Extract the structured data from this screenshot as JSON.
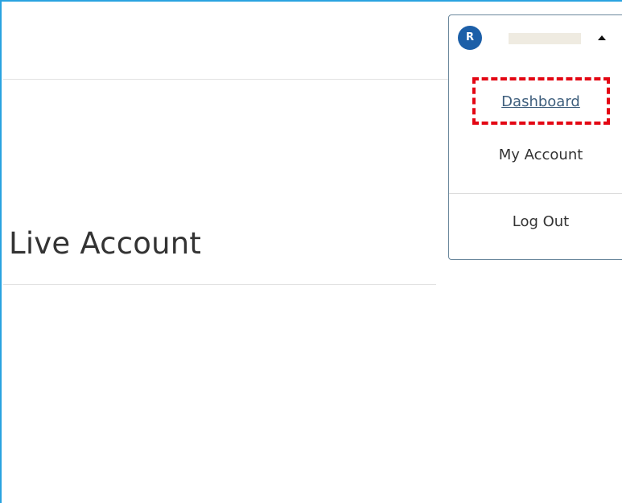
{
  "page": {
    "title": "Live Account"
  },
  "user_menu": {
    "avatar_initial": "R",
    "user_name": "",
    "items": [
      {
        "label": "Dashboard"
      },
      {
        "label": "My Account"
      },
      {
        "label": "Log Out"
      }
    ]
  },
  "colors": {
    "frame_border": "#29a3e0",
    "avatar_bg": "#1c5fa8",
    "highlight": "#e30613",
    "link": "#3f5f7d"
  },
  "icons": {
    "dropdown_toggle": "caret-up-icon"
  }
}
